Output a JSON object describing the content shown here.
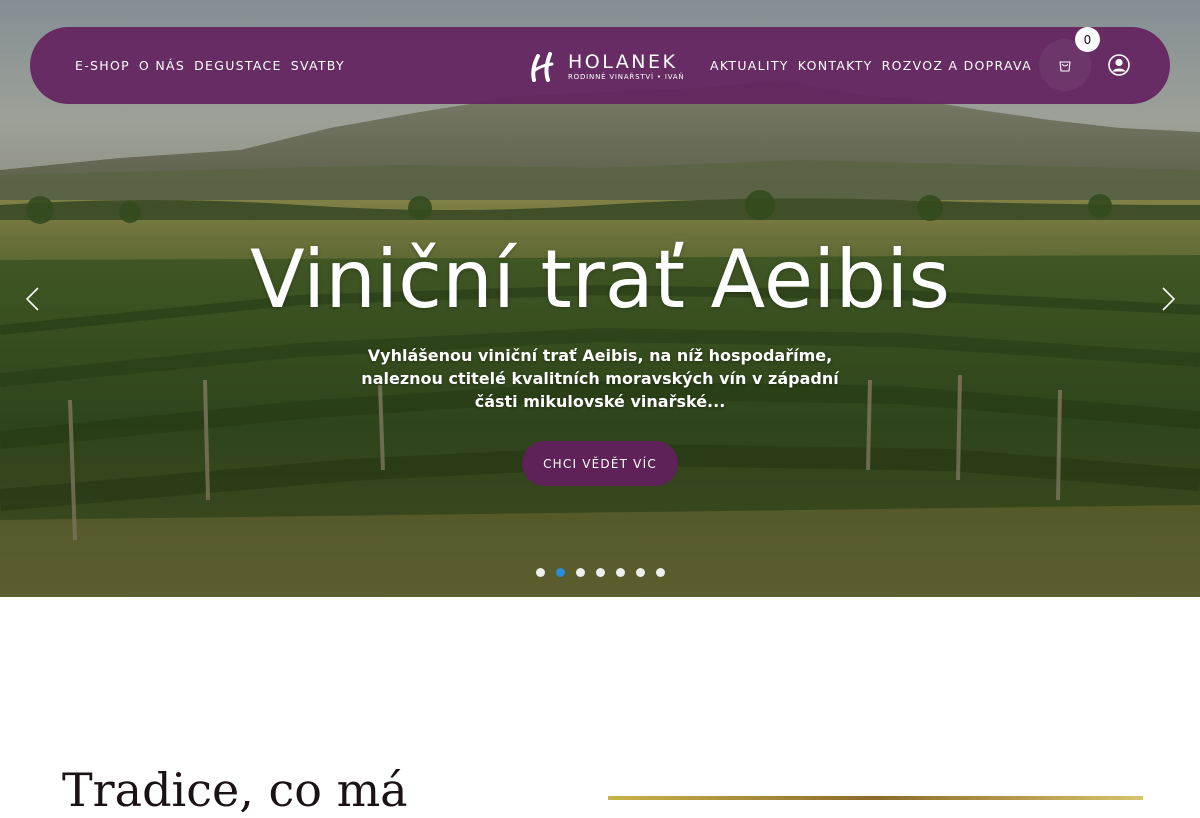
{
  "header": {
    "nav_left": [
      "E-SHOP",
      "O NÁS",
      "DEGUSTACE",
      "SVATBY"
    ],
    "nav_right": [
      "AKTUALITY",
      "KONTAKTY",
      "ROZVOZ A DOPRAVA"
    ],
    "logo": {
      "name": "HOLANEK",
      "tagline": "RODINNÉ VINAŘSTVÍ • IVAŇ"
    },
    "cart_count": "0",
    "icons": {
      "cart": "shopping-bag-icon",
      "account": "user-icon"
    },
    "brand_color": "#63245f"
  },
  "hero": {
    "title": "Viniční trať Aeibis",
    "description": "Vyhlášenou viniční trať Aeibis, na níž hospodaříme, naleznou ctitelé kvalitních moravských vín v západní části mikulovské vinařské...",
    "cta_label": "CHCI VĚDĚT VÍC",
    "slides_total": 7,
    "active_slide": 2,
    "accent_color": "#2a8bd6"
  },
  "section": {
    "heading": "Tradice, co má"
  }
}
